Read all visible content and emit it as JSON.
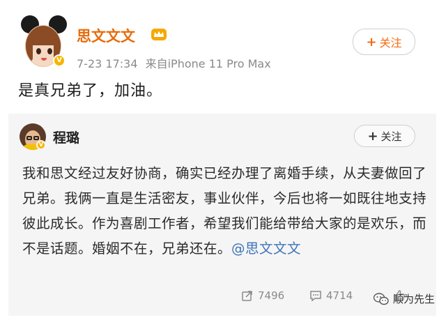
{
  "post": {
    "author_name": "思文文文",
    "timestamp": "7-23 17:34",
    "source": "来自iPhone 11 Pro Max",
    "text": "是真兄弟了，加油。",
    "follow_label": "关注"
  },
  "repost": {
    "author_name": "程璐",
    "follow_label": "关注",
    "text_before_mention": "我和思文经过友好协商，确实已经办理了离婚手续，从夫妻做回了兄弟。我俩一直是生活密友，事业伙伴，今后也将一如既往地支持彼此成长。作为喜剧工作者，希望我们能给带给大家的是欢乐，而不是话题。婚姻不在，兄弟还在。",
    "mention": "@思文文文",
    "repost_count": "7496",
    "comment_count": "4714"
  },
  "watermark": {
    "text": "顺为先生"
  },
  "icons": {
    "vip_badge": "verified-v-icon",
    "crown": "crown-icon",
    "repost": "repost-icon",
    "comment": "comment-icon",
    "like": "like-icon",
    "wechat": "wechat-icon"
  },
  "colors": {
    "author_orange": "#e86b0a",
    "follow_orange": "#f26c11",
    "mention_blue": "#3d72b6",
    "repost_bg": "#f5f5f5",
    "meta_gray": "#8a8a8a"
  }
}
